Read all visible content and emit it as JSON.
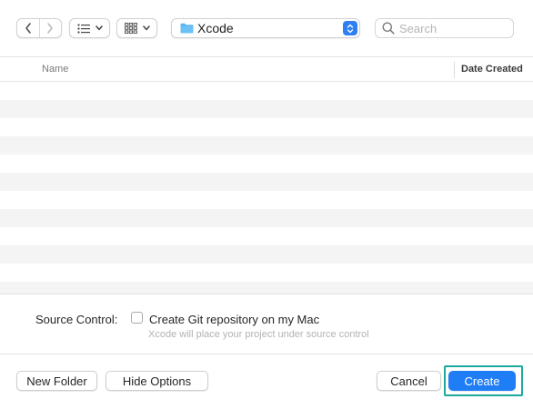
{
  "toolbar": {
    "location_label": "Xcode",
    "search_placeholder": "Search"
  },
  "table": {
    "columns": [
      "Name",
      "Date Created"
    ],
    "rows": []
  },
  "options": {
    "source_control_label": "Source Control:",
    "checkbox_label": "Create Git repository on my Mac",
    "checkbox_checked": false,
    "hint": "Xcode will place your project under source control"
  },
  "buttons": {
    "new_folder": "New Folder",
    "hide_options": "Hide Options",
    "cancel": "Cancel",
    "create": "Create"
  },
  "colors": {
    "accent": "#1f7df6",
    "highlight_ring": "#1aa89f",
    "folder": "#5ab5f0"
  }
}
